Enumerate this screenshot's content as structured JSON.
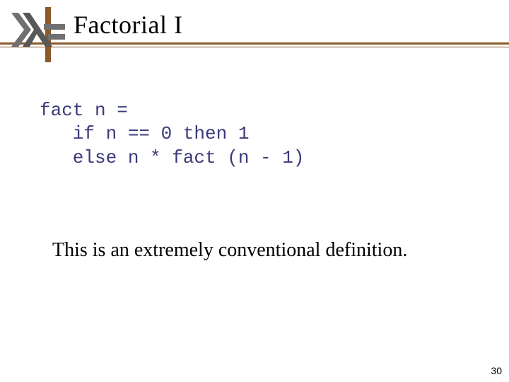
{
  "header": {
    "title": "Factorial I",
    "icon_name": "haskell-lambda-icon",
    "accent_color": "#8b5a2b"
  },
  "code": {
    "line1": "fact n =",
    "line2": "   if n == 0 then 1",
    "line3": "   else n * fact (n - 1)",
    "color": "#3a3a7a"
  },
  "caption": "This is an extremely conventional definition.",
  "page_number": "30"
}
